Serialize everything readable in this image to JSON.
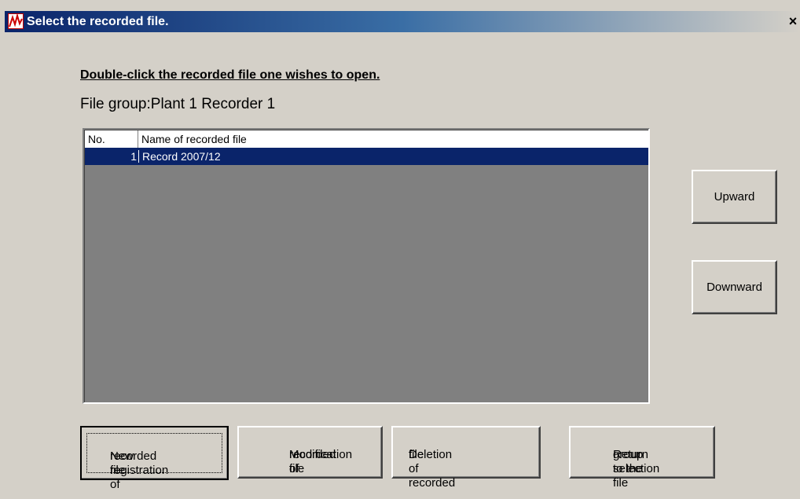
{
  "window": {
    "title": "Select the recorded file.",
    "close_label": "×"
  },
  "instruction": "Double-click the recorded file one wishes to open.",
  "file_group": {
    "text": "File group:Plant 1 Recorder 1"
  },
  "list": {
    "columns": [
      "No.",
      "Name of recorded file"
    ],
    "rows": [
      {
        "no": "1",
        "name": "Record 2007/12",
        "selected": true
      }
    ]
  },
  "buttons": {
    "upward": "Upward",
    "downward": "Downward",
    "new_registration": [
      "New registration of",
      "recorded file"
    ],
    "modification": [
      "Modification of",
      "recorded file"
    ],
    "deletion": [
      "Deletion of recorded",
      "file"
    ],
    "return_group": [
      "Return to the file",
      "group selection"
    ]
  },
  "colors": {
    "dialog_bg": "#d4d0c8",
    "title_gradient_start": "#0a246a",
    "selection": "#0a246a",
    "list_bg": "#808080"
  },
  "icons": {
    "app": "app-chart-icon",
    "close": "close-icon"
  }
}
